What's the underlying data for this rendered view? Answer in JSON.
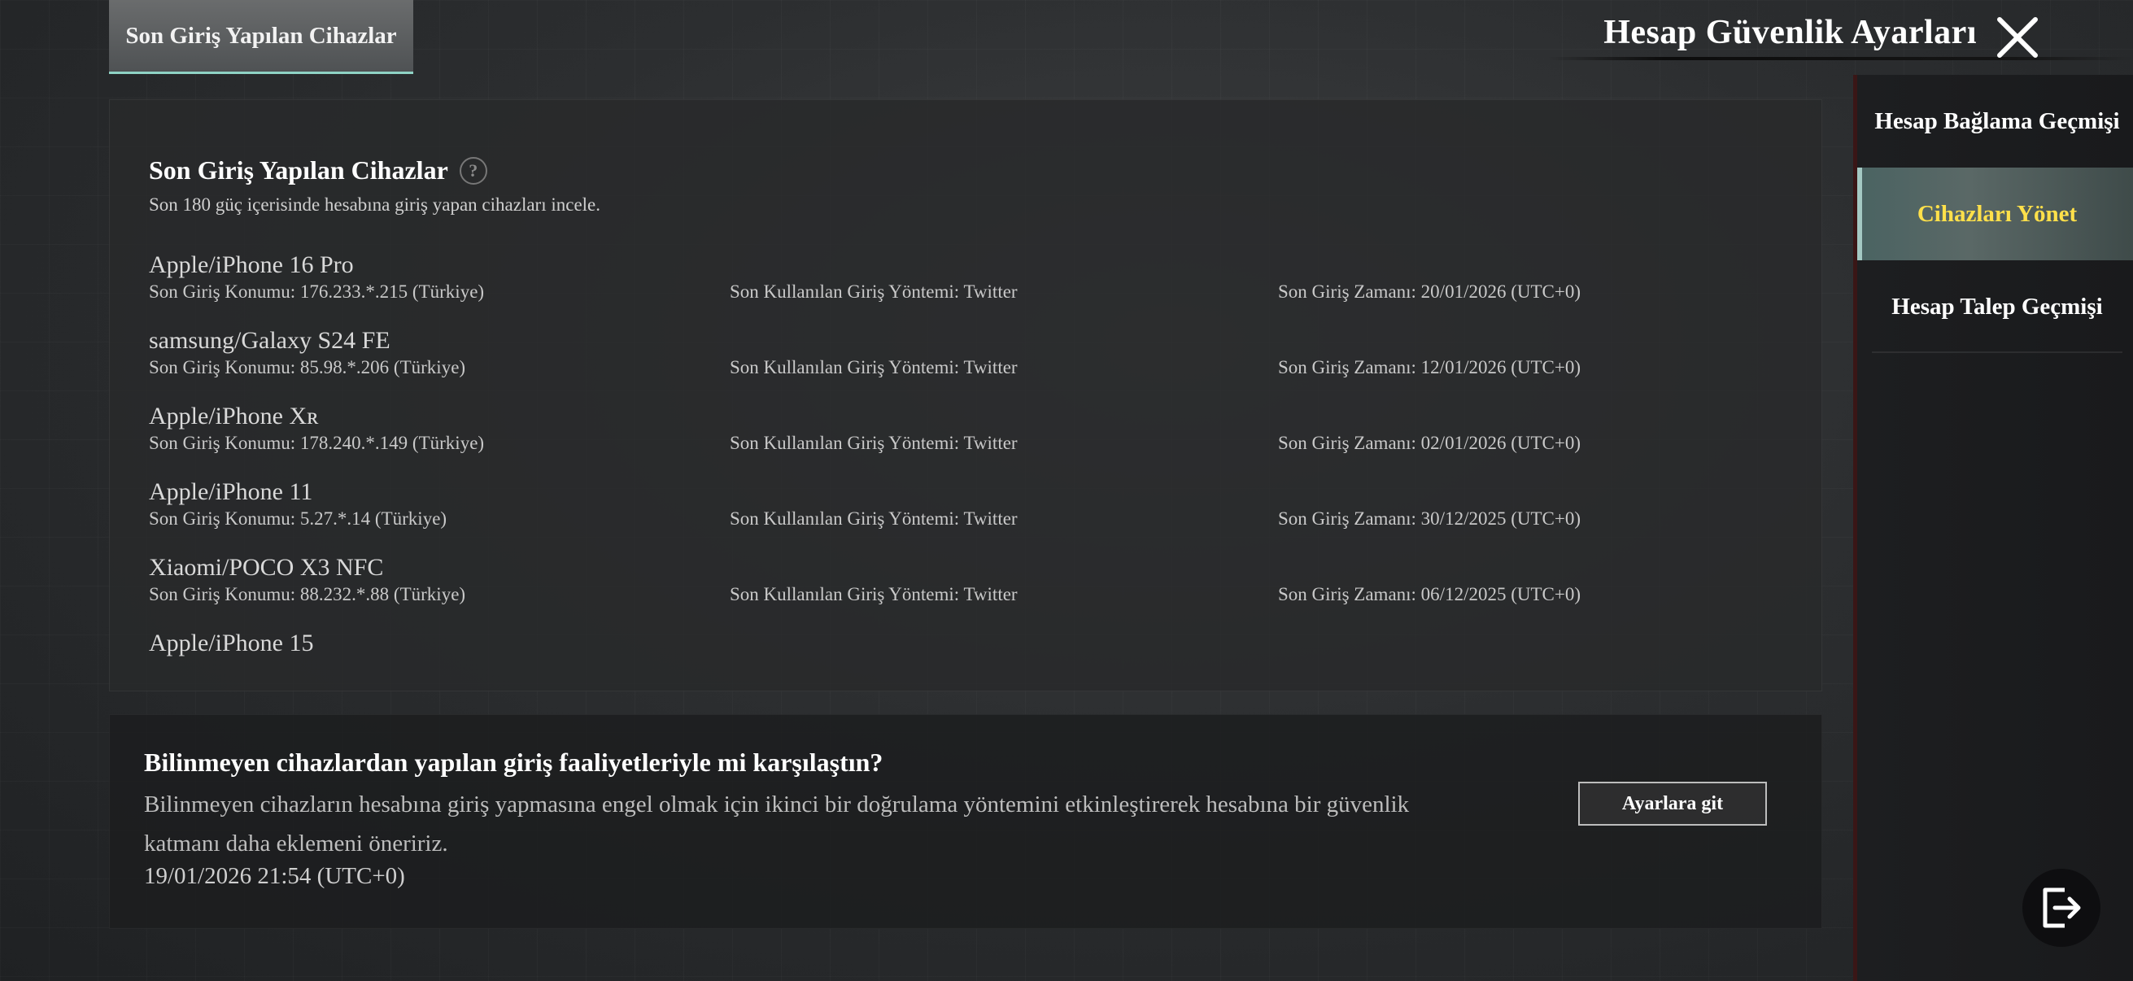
{
  "top_tab": {
    "label": "Son Giriş Yapılan Cihazlar"
  },
  "header": {
    "title": "Hesap Güvenlik Ayarları",
    "close_icon": "close-icon"
  },
  "panel": {
    "title": "Son Giriş Yapılan Cihazlar",
    "help_glyph": "?",
    "subtitle": "Son 180 güç içerisinde hesabına giriş yapan cihazları incele.",
    "devices": [
      {
        "name": "Apple/iPhone 16 Pro",
        "location": "Son Giriş Konumu: 176.233.*.215 (Türkiye)",
        "method": "Son Kullanılan Giriş Yöntemi: Twitter",
        "time": "Son Giriş Zamanı: 20/01/2026 (UTC+0)"
      },
      {
        "name": "samsung/Galaxy S24 FE",
        "location": "Son Giriş Konumu: 85.98.*.206 (Türkiye)",
        "method": "Son Kullanılan Giriş Yöntemi: Twitter",
        "time": "Son Giriş Zamanı: 12/01/2026 (UTC+0)"
      },
      {
        "name": "Apple/iPhone Xʀ",
        "location": "Son Giriş Konumu: 178.240.*.149 (Türkiye)",
        "method": "Son Kullanılan Giriş Yöntemi: Twitter",
        "time": "Son Giriş Zamanı: 02/01/2026 (UTC+0)"
      },
      {
        "name": "Apple/iPhone 11",
        "location": "Son Giriş Konumu: 5.27.*.14 (Türkiye)",
        "method": "Son Kullanılan Giriş Yöntemi: Twitter",
        "time": "Son Giriş Zamanı: 30/12/2025 (UTC+0)"
      },
      {
        "name": "Xiaomi/POCO X3 NFC",
        "location": "Son Giriş Konumu: 88.232.*.88 (Türkiye)",
        "method": "Son Kullanılan Giriş Yöntemi: Twitter",
        "time": "Son Giriş Zamanı: 06/12/2025 (UTC+0)"
      },
      {
        "name": "Apple/iPhone 15"
      }
    ]
  },
  "notice": {
    "title": "Bilinmeyen cihazlardan yapılan giriş faaliyetleriyle mi karşılaştın?",
    "body": "Bilinmeyen cihazların hesabına giriş yapmasına engel olmak için ikinci bir doğrulama yöntemini etkinleştirerek hesabına bir güvenlik katmanı daha eklemeni öneririz.",
    "timestamp": "19/01/2026 21:54 (UTC+0)",
    "button_label": "Ayarlara git"
  },
  "sidebar": {
    "items": [
      {
        "label": "Hesap Bağlama Geçmişi",
        "active": false
      },
      {
        "label": "Cihazları Yönet",
        "active": true
      },
      {
        "label": "Hesap Talep Geçmişi",
        "active": false
      }
    ]
  },
  "logout": {
    "icon": "logout-icon"
  },
  "colors": {
    "active_text": "#ffe04a",
    "tab_underline": "#8fd3c5"
  }
}
